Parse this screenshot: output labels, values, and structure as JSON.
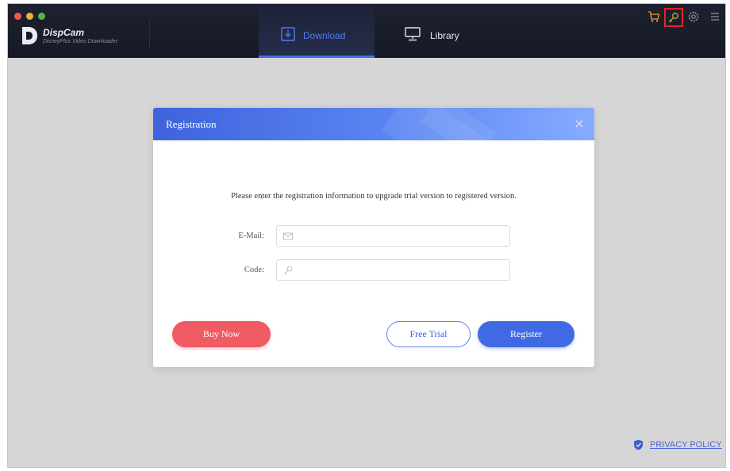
{
  "app": {
    "name": "DispCam",
    "subtitle": "DisneyPlus Video Downloader"
  },
  "tabs": [
    {
      "label": "Download",
      "icon": "download-icon",
      "active": true
    },
    {
      "label": "Library",
      "icon": "monitor-icon",
      "active": false
    }
  ],
  "toolbar": {
    "icons": [
      "cart-icon",
      "key-icon",
      "gear-icon",
      "menu-icon"
    ],
    "highlighted": "key-icon"
  },
  "dialog": {
    "title": "Registration",
    "message": "Please enter the registration information to upgrade trial version to registered version.",
    "email": {
      "label": "E-Mail:",
      "value": "",
      "placeholder": "",
      "icon": "mail-icon"
    },
    "code": {
      "label": "Code:",
      "value": "",
      "placeholder": "",
      "icon": "key-icon"
    },
    "buy_now": "Buy Now",
    "free_trial": "Free Trial",
    "register": "Register"
  },
  "footer": {
    "privacy": "PRIVACY POLICY",
    "icon": "shield-icon"
  },
  "colors": {
    "accent": "#3f6ae3",
    "buy_button": "#ef5a63",
    "titlebar": "#1a1d2b",
    "highlight_box": "#e52222"
  }
}
